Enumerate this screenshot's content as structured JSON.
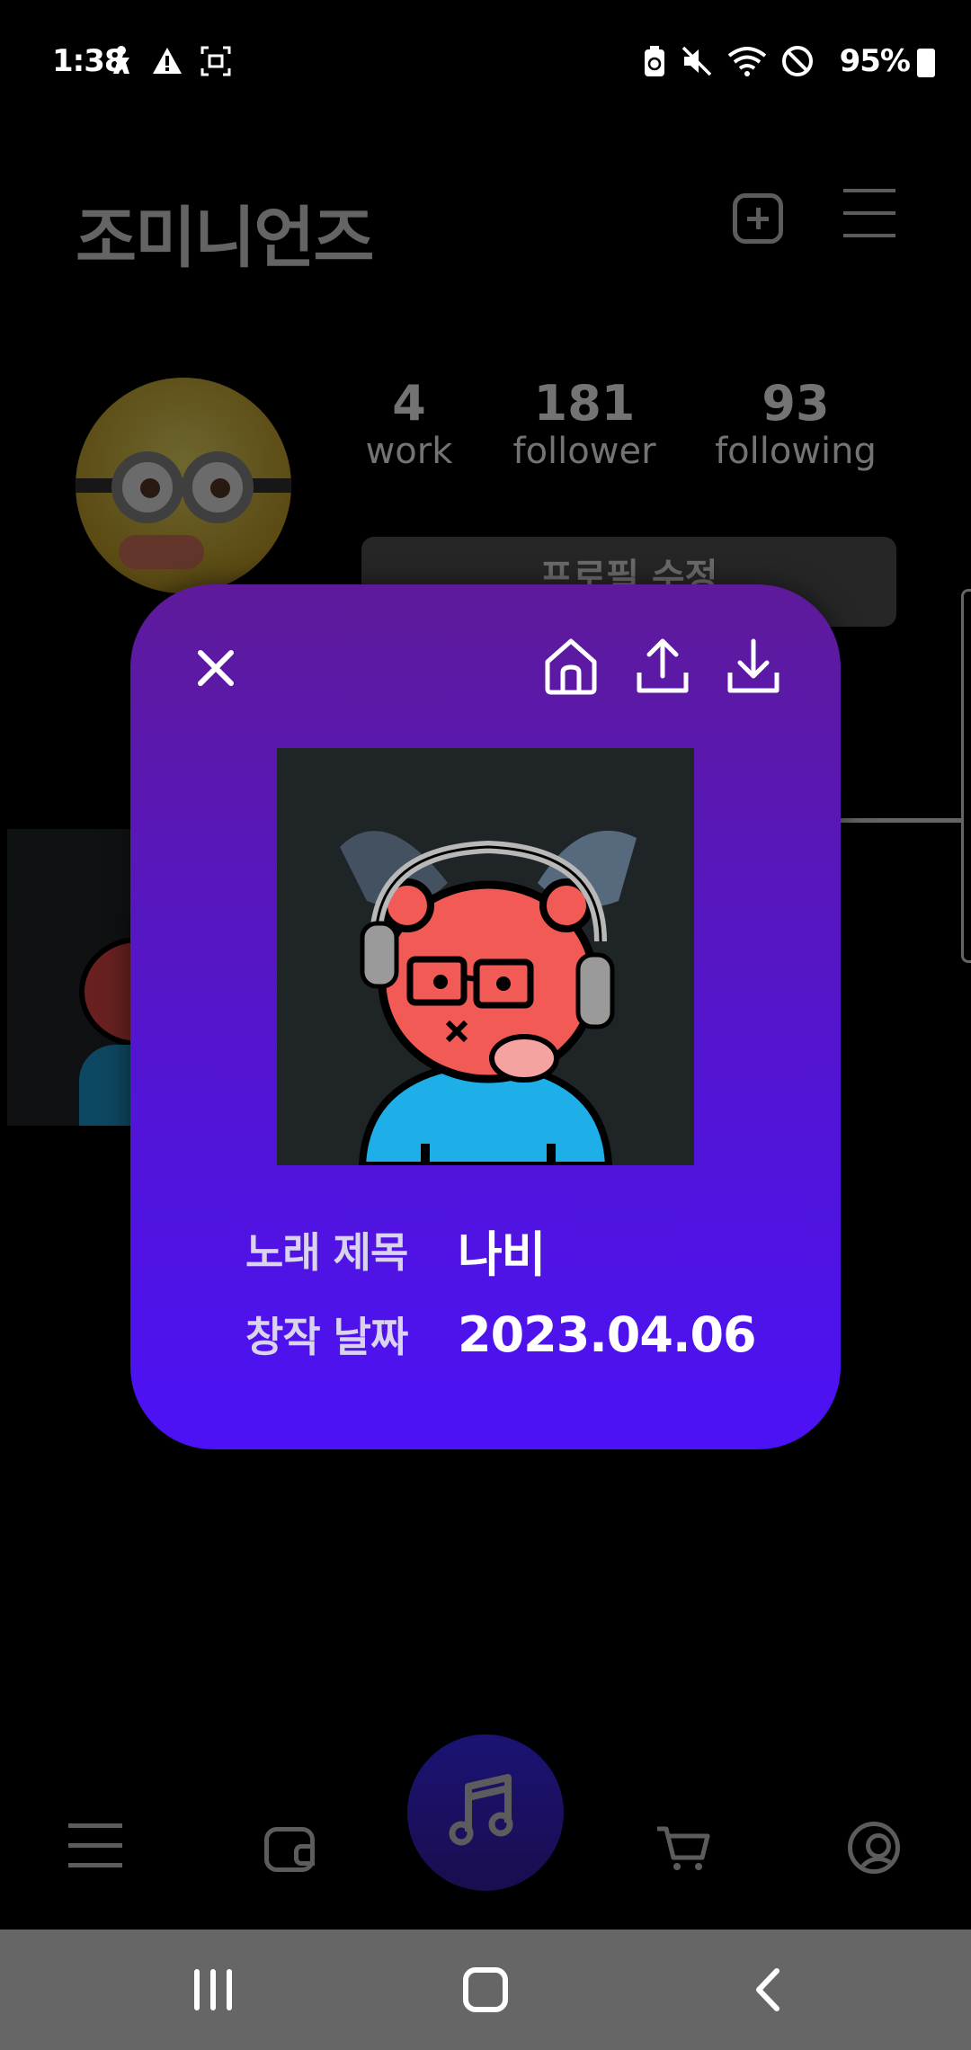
{
  "status_bar": {
    "time": "1:38",
    "battery_percent": "95%"
  },
  "header": {
    "app_title": "조미니언즈"
  },
  "profile": {
    "stats": [
      {
        "value": "4",
        "label": "work"
      },
      {
        "value": "181",
        "label": "follower"
      },
      {
        "value": "93",
        "label": "following"
      }
    ],
    "edit_button_label": "프로필 수정"
  },
  "modal": {
    "song_title_label": "노래 제목",
    "song_title": "나비",
    "created_date_label": "창작 날짜",
    "created_date": "2023.04.06",
    "actions": [
      "close-icon",
      "home-icon",
      "share-icon",
      "download-icon"
    ]
  },
  "bottom_nav": {
    "items": [
      "menu-icon",
      "wallet-icon",
      "music-icon",
      "cart-icon",
      "profile-icon"
    ],
    "accent_color": "#3a2bff"
  },
  "colors": {
    "modal_top": "#5e1a9a",
    "modal_bottom": "#4c12f6",
    "background": "#000000"
  }
}
